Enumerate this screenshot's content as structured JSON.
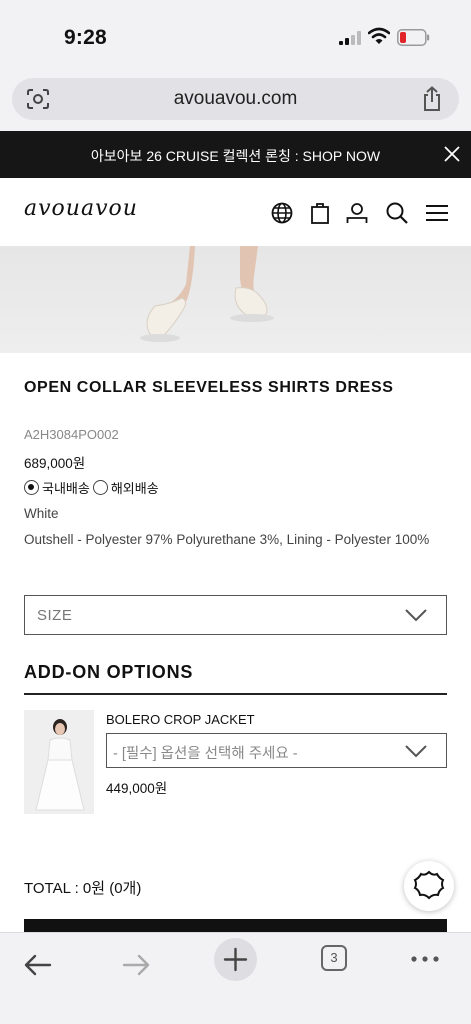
{
  "status_bar": {
    "time": "9:28"
  },
  "browser": {
    "url": "avouavou.com",
    "open_tab_count": "3"
  },
  "announcement": {
    "text": "아보아보 26 CRUISE 컬렉션 론칭 : SHOP NOW"
  },
  "site": {
    "logo": "avouavou"
  },
  "product": {
    "title": "OPEN COLLAR SLEEVELESS SHIRTS DRESS",
    "code": "A2H3084PO002",
    "price": "689,000원",
    "shipping_options": [
      {
        "label": "국내배송",
        "selected": true
      },
      {
        "label": "해외배송",
        "selected": false
      }
    ],
    "color": "White",
    "material": "Outshell - Polyester 97% Polyurethane 3%, Lining - Polyester 100%"
  },
  "size_select": {
    "value": "SIZE"
  },
  "addons": {
    "title": "ADD-ON OPTIONS",
    "items": [
      {
        "name": "BOLERO CROP JACKET",
        "select_placeholder": "- [필수] 옵션을 선택해 주세요 -",
        "price": "449,000원"
      }
    ]
  },
  "total": {
    "text": "TOTAL : 0원 (0개)"
  },
  "colors": {
    "announce_bg": "#161616",
    "battery_low": "#e0242a"
  }
}
